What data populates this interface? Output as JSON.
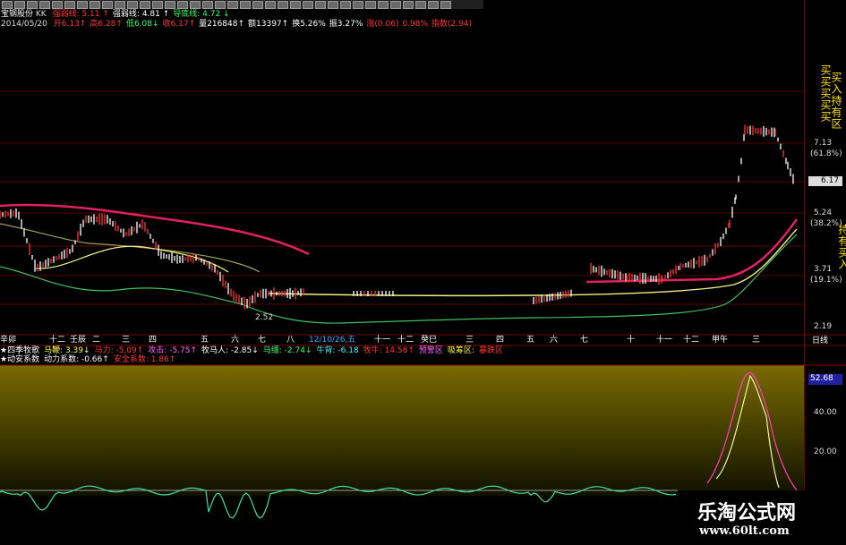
{
  "header": {
    "stock_name": "宝钢股份",
    "code_tag": "KK",
    "lines": [
      {
        "label": "强弱线:",
        "value": "5.11",
        "arrow": "↑",
        "color": "#ff3333"
      },
      {
        "label": "强弱线:",
        "value": "4.81",
        "arrow": "↑",
        "color": "#ffffff"
      },
      {
        "label": "导底线:",
        "value": "4.72",
        "arrow": "↓",
        "color": "#33ff66"
      }
    ],
    "date": "2014/05/20",
    "ohlc": [
      {
        "label": "开",
        "value": "6.13",
        "arrow": "↑",
        "color": "#ff3333"
      },
      {
        "label": "高",
        "value": "6.28",
        "arrow": "↑",
        "color": "#ff3333"
      },
      {
        "label": "低",
        "value": "6.08",
        "arrow": "↓",
        "color": "#33ff66"
      },
      {
        "label": "收",
        "value": "6.17",
        "arrow": "↑",
        "color": "#ff3333"
      },
      {
        "label": "量",
        "value": "216848",
        "arrow": "↑",
        "color": "#ffffff"
      },
      {
        "label": "额",
        "value": "13397",
        "arrow": "↑",
        "color": "#ffffff"
      },
      {
        "label": "换",
        "value": "5.26%",
        "arrow": "",
        "color": "#ffffff"
      },
      {
        "label": "振",
        "value": "3.27%",
        "arrow": "",
        "color": "#ffffff"
      },
      {
        "label": "涨",
        "value": "(0.06)",
        "arrow": "",
        "color": "#ff3333"
      },
      {
        "label": "",
        "value": "0.98%",
        "arrow": "",
        "color": "#ff3333"
      },
      {
        "label": "指数",
        "value": "(2.94)",
        "arrow": "",
        "color": "#ff3333"
      }
    ]
  },
  "price_axis": {
    "ticks": [
      {
        "value": "7.13",
        "pct": "(61.8%)"
      },
      {
        "value": "5.24",
        "pct": "(38.2%)"
      },
      {
        "value": "3.71",
        "pct": "(19.1%)"
      },
      {
        "value": "2.19",
        "pct": ""
      }
    ],
    "current_price": "6.17",
    "low_marker": "2.52",
    "date_marker": "12/10/26,五"
  },
  "time_axis": {
    "labels": [
      "辛卯",
      "十二",
      "壬辰",
      "二",
      "三",
      "四",
      "五",
      "六",
      "七",
      "八",
      "十一",
      "十二",
      "癸巳",
      "三",
      "四",
      "五",
      "六",
      "七",
      "十",
      "十一",
      "十二",
      "甲午",
      "三"
    ],
    "cycle_label": "日线"
  },
  "indicator_bar": {
    "row1": [
      {
        "text": "★四季牧歌",
        "color": "#ffffff"
      },
      {
        "text": "马鞭: 3.39↓",
        "color": "#ffff44"
      },
      {
        "text": "马力: -5.09↑",
        "color": "#ff3333"
      },
      {
        "text": "攻击: -5.75↑",
        "color": "#ff66ff"
      },
      {
        "text": "牧马人: -2.85↓",
        "color": "#ffffff"
      },
      {
        "text": "马缰: -2.74↓",
        "color": "#33ff66"
      },
      {
        "text": "牛背: -6.18",
        "color": "#33ffff"
      },
      {
        "text": "牧牛: 14.58↑",
        "color": "#ff3333"
      },
      {
        "text": "预警区",
        "color": "#ff66ff"
      },
      {
        "text": "吸筹区:",
        "color": "#ffff44"
      },
      {
        "text": "暴跌区",
        "color": "#ff3333"
      }
    ],
    "row2": [
      {
        "text": "★动安系数",
        "color": "#ffffff"
      },
      {
        "text": "动力系数: -0.66↑",
        "color": "#ffffff"
      },
      {
        "text": "安全系数: 1.86↑",
        "color": "#ff3333"
      }
    ]
  },
  "lower_axis": {
    "highlight_value": "52.68",
    "ticks": [
      "40.00",
      "20.00"
    ]
  },
  "side_text": {
    "left_col": "买买买买买",
    "right_col": "买入持有区",
    "third_col": "持有买入"
  },
  "watermark": {
    "title": "乐淘公式网",
    "url": "www.60lt.com"
  },
  "colors": {
    "background": "#000000",
    "axis_red": "#7a0000",
    "candle_up": "#ff3333",
    "candle_down": "#ffffff",
    "ma_red": "#e02060",
    "ma_yellow": "#f0f080",
    "ma_green": "#40c060",
    "ma_olive": "#a0a060"
  }
}
